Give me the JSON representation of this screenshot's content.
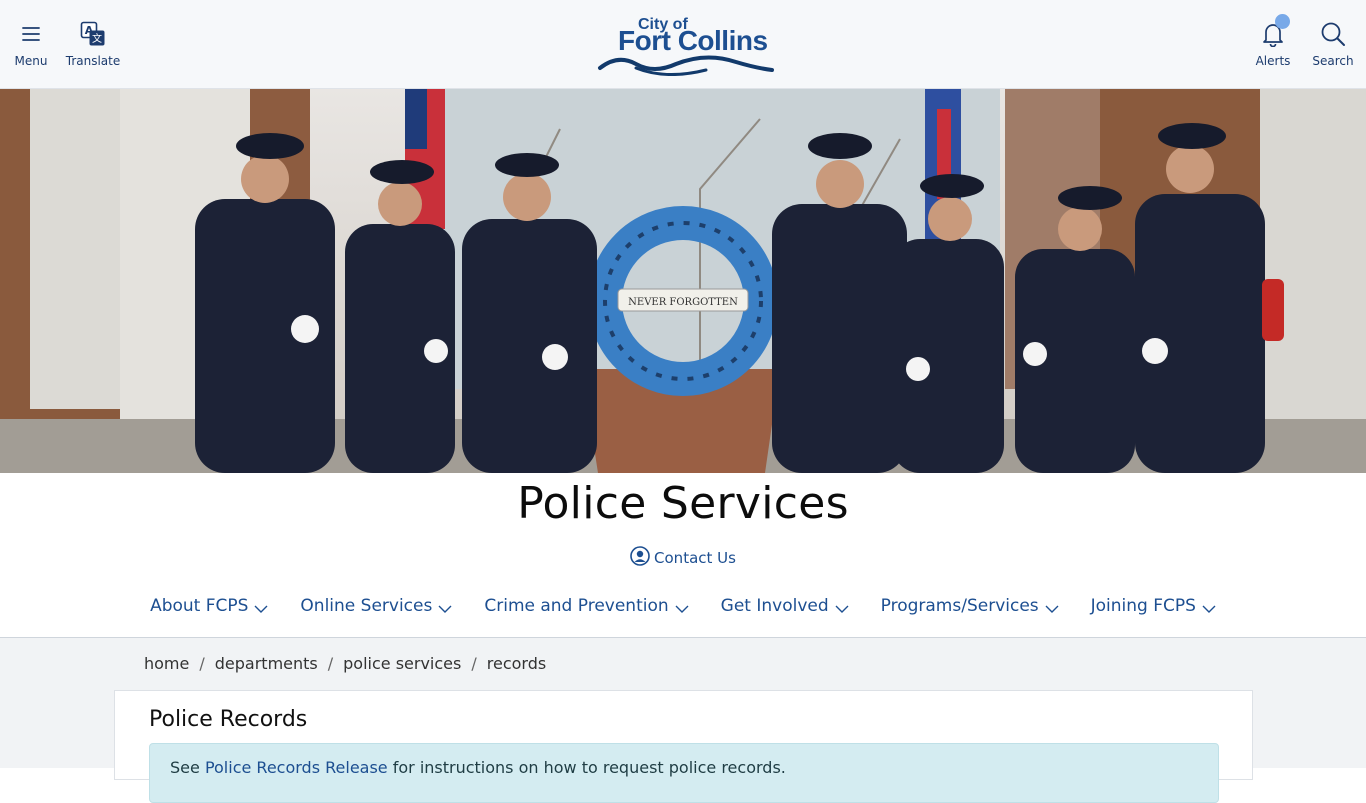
{
  "topbar": {
    "menu_label": "Menu",
    "translate_label": "Translate",
    "alerts_label": "Alerts",
    "search_label": "Search"
  },
  "logo": {
    "line1": "City of",
    "line2": "Fort Collins"
  },
  "hero": {
    "wreath_text": "NEVER FORGOTTEN"
  },
  "page": {
    "title": "Police Services",
    "contact_label": "Contact Us"
  },
  "subnav": {
    "items": [
      {
        "label": "About FCPS"
      },
      {
        "label": "Online Services"
      },
      {
        "label": "Crime and Prevention"
      },
      {
        "label": "Get Involved"
      },
      {
        "label": "Programs/Services"
      },
      {
        "label": "Joining FCPS"
      }
    ]
  },
  "breadcrumb": {
    "items": [
      "home",
      "departments",
      "police services",
      "records"
    ],
    "separator": "/"
  },
  "content": {
    "card_title": "Police Records",
    "info_prefix": "See ",
    "info_link": "Police Records Release",
    "info_suffix": " for instructions on how to request police records."
  },
  "colors": {
    "brand_blue": "#1d4f91",
    "logo_navy": "#123a6b",
    "topbar_bg": "#f6f8fa",
    "info_bg": "#d4ecf1"
  },
  "icons": [
    "menu-icon",
    "translate-icon",
    "bell-icon",
    "search-icon",
    "user-circle-icon",
    "chevron-down-icon"
  ]
}
